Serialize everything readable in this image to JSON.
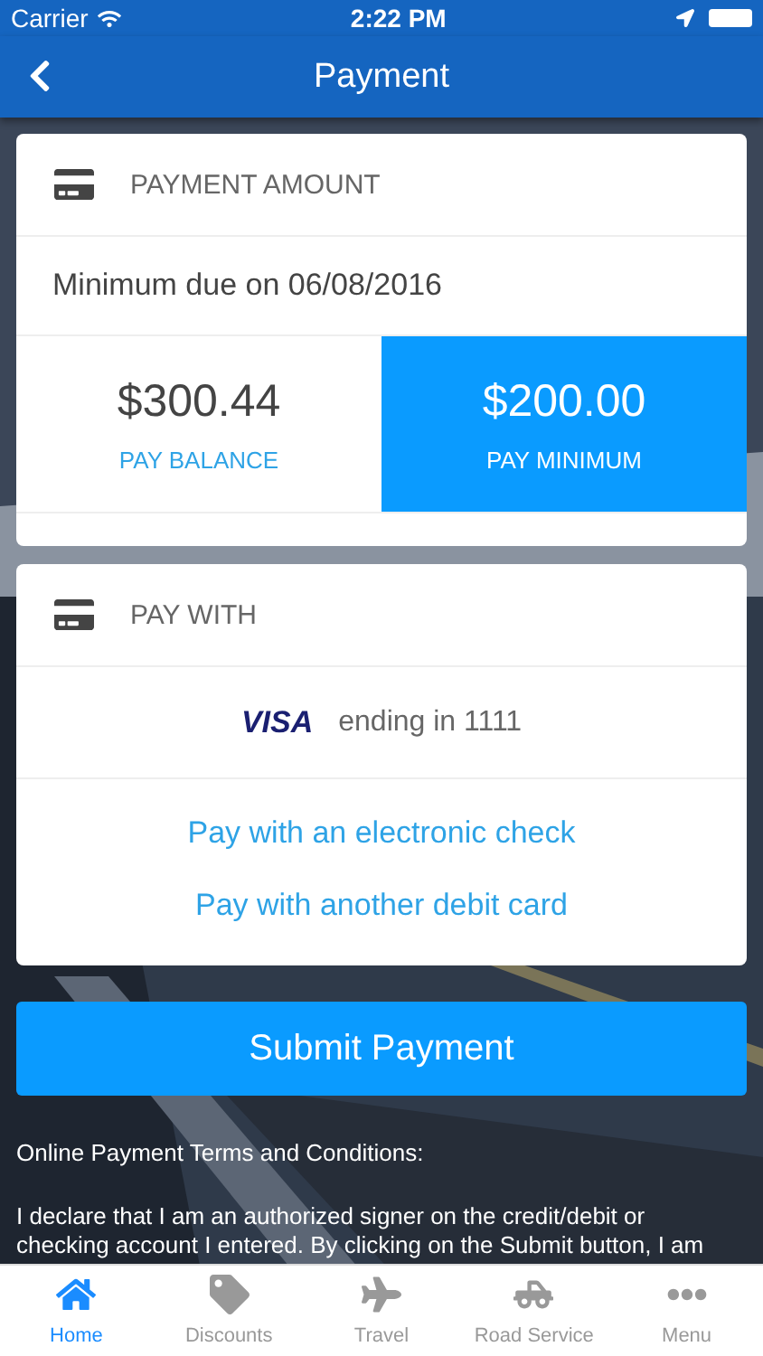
{
  "status_bar": {
    "carrier": "Carrier",
    "time": "2:22 PM"
  },
  "nav": {
    "title": "Payment"
  },
  "amount_card": {
    "title": "PAYMENT AMOUNT",
    "due": "Minimum due on 06/08/2016",
    "options": [
      {
        "amount": "$300.44",
        "label": "PAY BALANCE",
        "selected": false
      },
      {
        "amount": "$200.00",
        "label": "PAY MINIMUM",
        "selected": true
      }
    ]
  },
  "pay_with_card": {
    "title": "PAY WITH",
    "card_brand": "VISA",
    "card_text": "ending in 1111",
    "links": [
      "Pay with an electronic check",
      "Pay with another debit card"
    ]
  },
  "submit": "Submit Payment",
  "terms": {
    "title": "Online Payment Terms and Conditions:",
    "body": "I declare that I am an authorized signer on the credit/debit or checking account I entered. By clicking on the Submit button, I am"
  },
  "tabs": [
    {
      "label": "Home",
      "kind": "home",
      "selected": true
    },
    {
      "label": "Discounts",
      "kind": "discounts",
      "selected": false
    },
    {
      "label": "Travel",
      "kind": "travel",
      "selected": false
    },
    {
      "label": "Road Service",
      "kind": "road",
      "selected": false
    },
    {
      "label": "Menu",
      "kind": "menu",
      "selected": false
    }
  ]
}
